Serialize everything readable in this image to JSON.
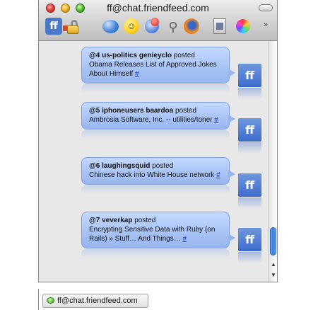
{
  "window": {
    "title": "ff@chat.friendfeed.com"
  },
  "toolbar": {
    "icons": [
      "friendfeed-icon",
      "lock-icon",
      "chat-bubble-icon",
      "smiley-icon",
      "status-icon",
      "plug-icon",
      "firefox-icon",
      "document-icon",
      "color-wheel-icon"
    ],
    "overflow": "»"
  },
  "messages": [
    {
      "number": "@4",
      "user": "us-politics genieyclo",
      "verb": "posted",
      "text": "Obama Releases List of Approved Jokes About Himself",
      "link": "#"
    },
    {
      "number": "@5",
      "user": "iphoneusers baardoa",
      "verb": "posted",
      "text": "Ambrosia Software, Inc. -- utilities/toner",
      "link": "#"
    },
    {
      "number": "@6",
      "user": "laughingsquid",
      "verb": "posted",
      "text": "Chinese hack into White House network",
      "link": "#"
    },
    {
      "number": "@7",
      "user": "veverkap",
      "verb": "posted",
      "text": "Encrypting Sensitive Data with Ruby (on Rails) » Stuff… And Things…",
      "link": "#"
    }
  ],
  "avatar_glyph": "ff",
  "scrollbar": {
    "up": "▲",
    "down": "▼",
    "position": 0.9
  },
  "tab": {
    "label": "ff@chat.friendfeed.com"
  }
}
